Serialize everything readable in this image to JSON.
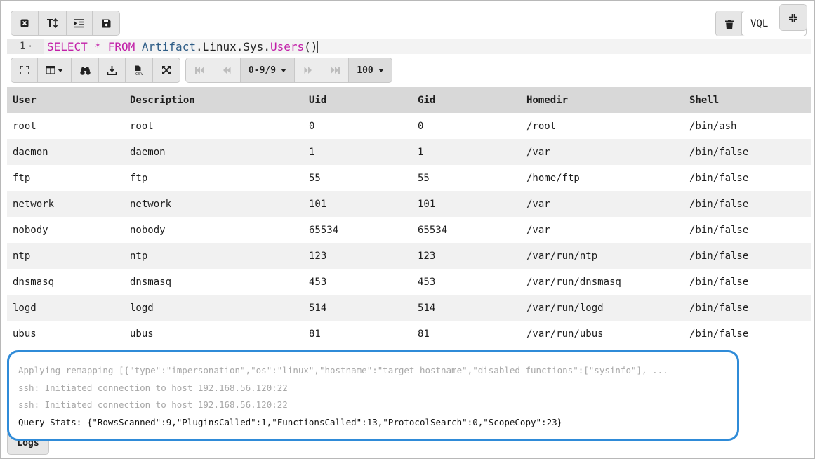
{
  "editor": {
    "line_number": "1",
    "fold_marker": "·",
    "code": {
      "select": "SELECT",
      "star": "*",
      "from": "FROM",
      "artifact": "Artifact",
      "dot1": ".",
      "linux": "Linux",
      "dot2": ".",
      "sys": "Sys",
      "dot3": ".",
      "users": "Users",
      "parens": "()"
    }
  },
  "top_toolbar": {
    "vql_label": "VQL"
  },
  "results_toolbar": {
    "page_range": "0-9/9",
    "page_size": "100"
  },
  "table": {
    "columns": [
      "User",
      "Description",
      "Uid",
      "Gid",
      "Homedir",
      "Shell"
    ],
    "rows": [
      [
        "root",
        "root",
        "0",
        "0",
        "/root",
        "/bin/ash"
      ],
      [
        "daemon",
        "daemon",
        "1",
        "1",
        "/var",
        "/bin/false"
      ],
      [
        "ftp",
        "ftp",
        "55",
        "55",
        "/home/ftp",
        "/bin/false"
      ],
      [
        "network",
        "network",
        "101",
        "101",
        "/var",
        "/bin/false"
      ],
      [
        "nobody",
        "nobody",
        "65534",
        "65534",
        "/var",
        "/bin/false"
      ],
      [
        "ntp",
        "ntp",
        "123",
        "123",
        "/var/run/ntp",
        "/bin/false"
      ],
      [
        "dnsmasq",
        "dnsmasq",
        "453",
        "453",
        "/var/run/dnsmasq",
        "/bin/false"
      ],
      [
        "logd",
        "logd",
        "514",
        "514",
        "/var/run/logd",
        "/bin/false"
      ],
      [
        "ubus",
        "ubus",
        "81",
        "81",
        "/var/run/ubus",
        "/bin/false"
      ]
    ]
  },
  "logs": {
    "lines": [
      "Applying remapping [{\"type\":\"impersonation\",\"os\":\"linux\",\"hostname\":\"target-hostname\",\"disabled_functions\":[\"sysinfo\"], ...",
      "ssh: Initiated connection to host 192.168.56.120:22",
      "ssh: Initiated connection to host 192.168.56.120:22",
      "Query Stats: {\"RowsScanned\":9,\"PluginsCalled\":1,\"FunctionsCalled\":13,\"ProtocolSearch\":0,\"ScopeCopy\":23}"
    ],
    "tab_label": "Logs"
  },
  "colors": {
    "keyword": "#c21fa8",
    "identifier": "#2d5c86",
    "logs_border": "#2f8bd8",
    "header_bg": "#d8d8d8"
  },
  "icons": {
    "top_toolbar": [
      "close-square-icon",
      "text-size-icon",
      "indent-icon",
      "save-icon"
    ],
    "right": [
      "trash-icon",
      "compress-icon"
    ],
    "results_toolbar": [
      "fullscreen-icon",
      "columns-icon",
      "binoculars-icon",
      "download-icon",
      "csv-file-icon",
      "expand-arrows-icon",
      "first-page-icon",
      "previous-page-icon",
      "next-page-icon",
      "last-page-icon"
    ]
  }
}
